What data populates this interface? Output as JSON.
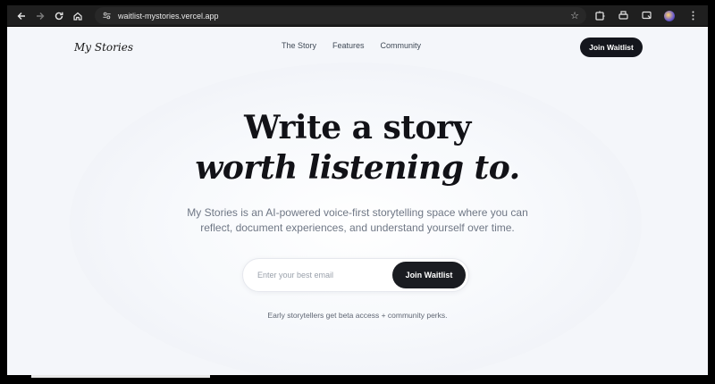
{
  "browser": {
    "url": "waitlist-mystories.vercel.app"
  },
  "site": {
    "brand": "My Stories",
    "nav": [
      {
        "label": "The Story"
      },
      {
        "label": "Features"
      },
      {
        "label": "Community"
      }
    ],
    "cta_top": "Join Waitlist"
  },
  "hero": {
    "line1": "Write a story",
    "line2": "worth listening to.",
    "subtitle": "My Stories is an AI-powered voice-first storytelling space where you can reflect, document experiences, and understand yourself over time.",
    "email_placeholder": "Enter your best email",
    "email_value": "",
    "cta": "Join Waitlist",
    "note": "Early storytellers get beta access + community perks."
  },
  "colors": {
    "cta_bg": "#14161d",
    "page_bg": "#f4f6fa",
    "heading": "#121217",
    "body_text": "#6f7785"
  }
}
